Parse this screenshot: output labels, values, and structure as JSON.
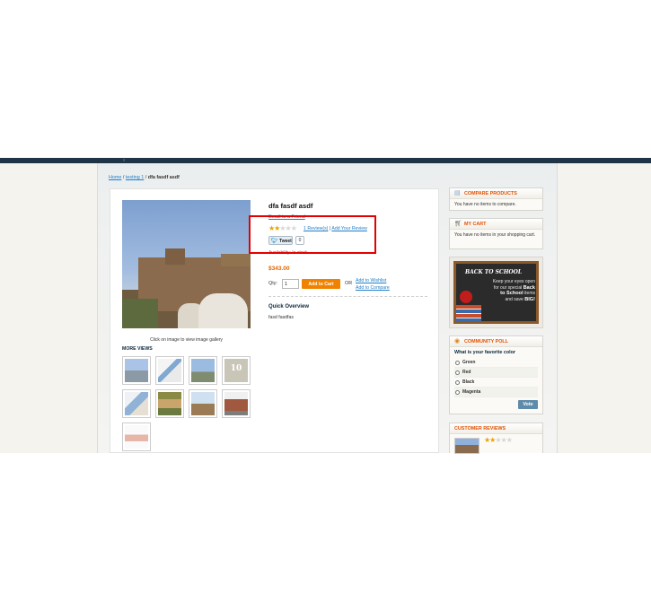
{
  "breadcrumb": {
    "home": "Home",
    "sep1": "/",
    "category": "testing 1",
    "sep2": "/",
    "current": "dfa fasdf asdf"
  },
  "product": {
    "name": "dfa fasdf asdf",
    "email_friend": "Email to a Friend",
    "rating_stars": {
      "filled": 2,
      "total": 5
    },
    "reviews_link": "1 Review(s)",
    "review_sep": "|",
    "add_review_link": "Add Your Review",
    "tweet_label": "Tweet",
    "tweet_count": "0",
    "availability": "Availability: In stock",
    "price": "$343.00",
    "qty_label": "Qty:",
    "qty_value": "1",
    "add_to_cart": "Add to Cart",
    "or_label": "OR",
    "add_to_wishlist": "Add to Wishlist",
    "add_to_compare": "Add to Compare",
    "quick_overview_title": "Quick Overview",
    "quick_overview_text": "fasd fasdfas",
    "image_caption": "Click on image to view image gallery",
    "more_views_title": "MORE VIEWS"
  },
  "sidebar": {
    "compare": {
      "title": "COMPARE PRODUCTS",
      "text": "You have no items to compare."
    },
    "cart": {
      "title": "MY CART",
      "text": "You have no items in your shopping cart."
    },
    "promo": {
      "title": "BACK TO SCHOOL",
      "line1": "Keep your eyes open",
      "line2": "for our special",
      "line2_bold": "Back",
      "line3_bold": "to School",
      "line3": "items",
      "line4": "and save",
      "line4_bold": "BIG!"
    },
    "poll": {
      "title": "COMMUNITY POLL",
      "question": "What is your favorite color",
      "options": [
        "Green",
        "Red",
        "Black",
        "Magenta"
      ],
      "vote_label": "Vote"
    },
    "reviews": {
      "title": "CUSTOMER REVIEWS",
      "stars_filled": 2,
      "stars_total": 5
    }
  },
  "colors": {
    "accent_orange": "#f18200",
    "link_blue": "#1e7ec8",
    "header_dark": "#1f3447",
    "highlight_red": "#e50000"
  },
  "icons": {
    "compare": "compare-icon",
    "cart": "cart-icon",
    "poll": "poll-icon",
    "twitter": "twitter-bird-icon",
    "star": "star-icon"
  }
}
